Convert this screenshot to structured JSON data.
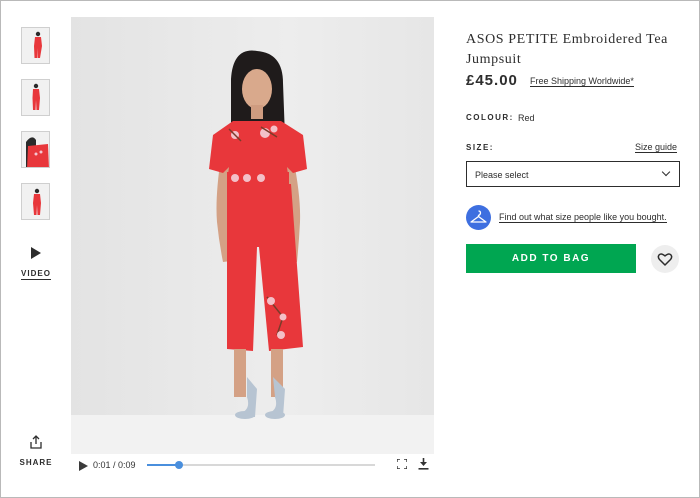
{
  "gallery": {
    "thumbnails": [
      {
        "icon": "product-thumbnail-front"
      },
      {
        "icon": "product-thumbnail-side"
      },
      {
        "icon": "product-thumbnail-detail"
      },
      {
        "icon": "product-thumbnail-back"
      }
    ],
    "video_label": "VIDEO",
    "share_label": "SHARE"
  },
  "video": {
    "time": "0:01 / 0:09",
    "progress": 0.14,
    "dress_color": "#e8373b"
  },
  "product": {
    "title": "ASOS PETITE Embroidered Tea Jumpsuit",
    "price": "£45.00",
    "shipping": "Free Shipping Worldwide*",
    "colour_label": "COLOUR:",
    "colour_value": "Red",
    "size_label": "SIZE:",
    "size_guide": "Size guide",
    "size_select": "Please select",
    "fit_link": "Find out what size people like you bought.",
    "add_to_bag": "ADD TO BAG"
  },
  "colors": {
    "add_to_bag": "#00a651",
    "fit_badge": "#3e6fe0",
    "progress": "#4a8fdd"
  }
}
